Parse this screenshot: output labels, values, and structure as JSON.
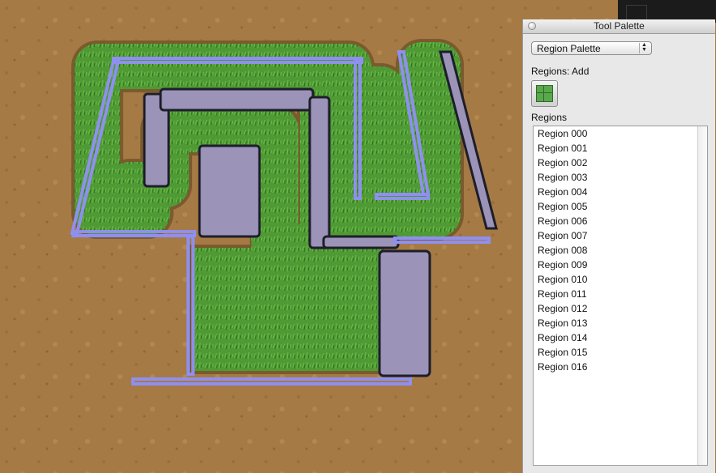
{
  "palette": {
    "title": "Tool Palette",
    "dropdown_value": "Region Palette",
    "regions_add_label": "Regions: Add",
    "regions_label": "Regions",
    "regions": [
      "Region 000",
      "Region 001",
      "Region 002",
      "Region 003",
      "Region 004",
      "Region 005",
      "Region 006",
      "Region 007",
      "Region 008",
      "Region 009",
      "Region 010",
      "Region 011",
      "Region 012",
      "Region 013",
      "Region 014",
      "Region 015",
      "Region 016"
    ]
  },
  "icons": [
    "close-icon",
    "popup-arrows-icon",
    "region-tile-icon"
  ],
  "colors": {
    "dirt": "#a57a45",
    "grass": "#4f9a35",
    "region_outline": "#8f8ff0",
    "region_fill": "#9b93b8"
  }
}
